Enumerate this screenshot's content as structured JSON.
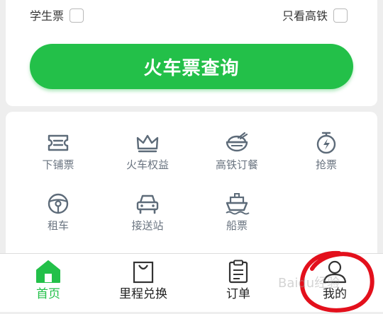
{
  "options": {
    "student_label": "学生票",
    "gaotie_label": "只看高铁"
  },
  "search_button": "火车票查询",
  "services": [
    {
      "label": "下铺票",
      "icon": "ticket-icon"
    },
    {
      "label": "火车权益",
      "icon": "crown-icon"
    },
    {
      "label": "高铁订餐",
      "icon": "rice-bowl-icon"
    },
    {
      "label": "抢票",
      "icon": "stopwatch-icon"
    },
    {
      "label": "租车",
      "icon": "steering-wheel-icon"
    },
    {
      "label": "接送站",
      "icon": "car-icon"
    },
    {
      "label": "船票",
      "icon": "ship-icon"
    }
  ],
  "nav": [
    {
      "label": "首页",
      "icon": "home-icon",
      "active": true
    },
    {
      "label": "里程兑换",
      "icon": "shopping-bag-icon",
      "active": false
    },
    {
      "label": "订单",
      "icon": "clipboard-icon",
      "active": false
    },
    {
      "label": "我的",
      "icon": "user-icon",
      "active": false
    }
  ],
  "colors": {
    "accent": "#23c049",
    "icon": "#5d6b79",
    "annotation": "#e3101c"
  },
  "watermark": "Baidu经验"
}
